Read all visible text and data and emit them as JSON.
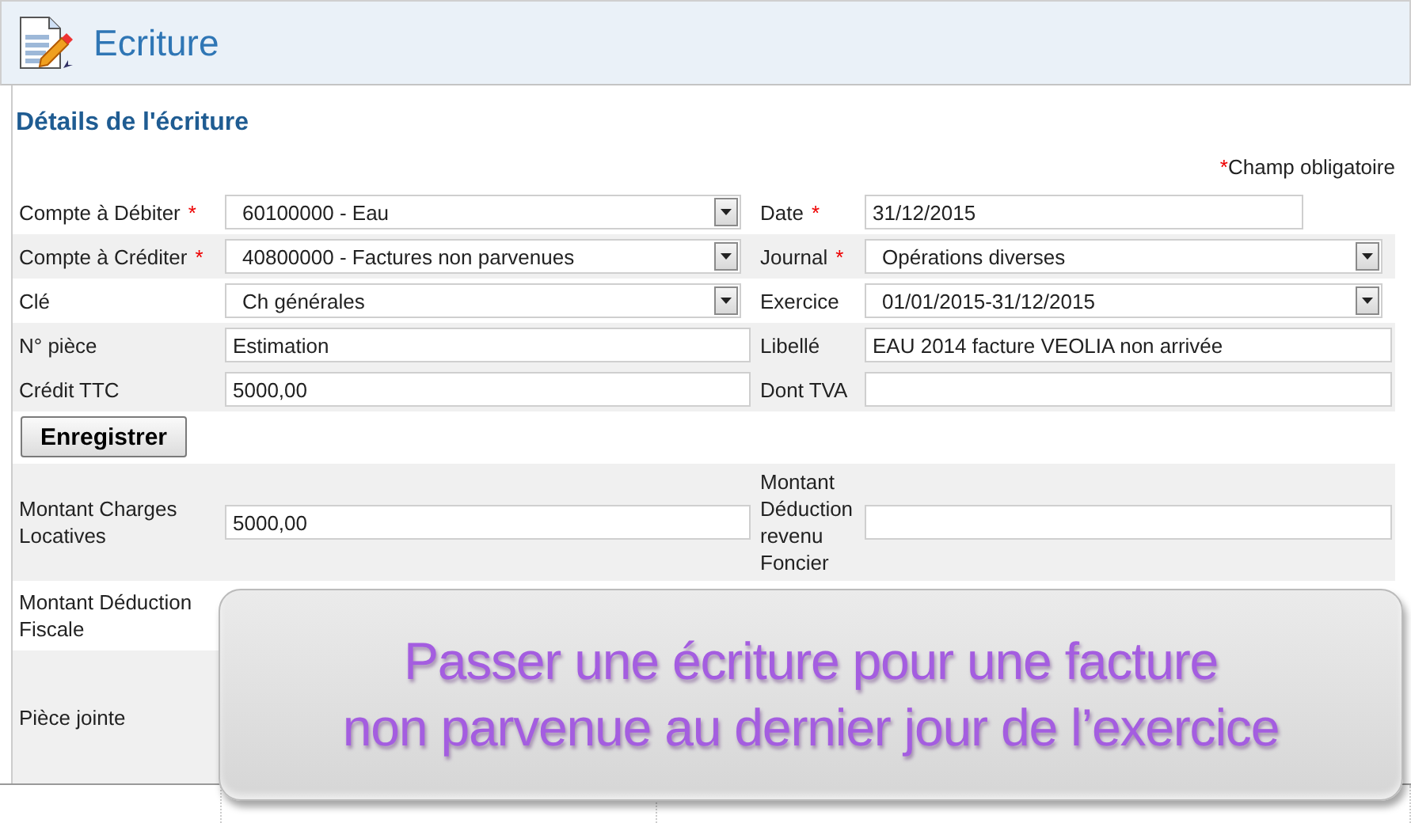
{
  "header": {
    "title": "Ecriture"
  },
  "section_title": "Détails de l'écriture",
  "required_note": {
    "mark": "*",
    "text": "Champ obligatoire"
  },
  "form_rows": [
    {
      "shaded": false,
      "cells": [
        {
          "label": "Compte à Débiter",
          "required": true,
          "field": {
            "kind": "select",
            "value": "60100000 - Eau"
          }
        },
        {
          "label": "Date",
          "required": true,
          "field": {
            "kind": "date",
            "value": "31/12/2015"
          }
        }
      ]
    },
    {
      "shaded": true,
      "cells": [
        {
          "label": "Compte à Créditer",
          "required": true,
          "field": {
            "kind": "select",
            "value": "40800000 - Factures non parvenues"
          }
        },
        {
          "label": "Journal",
          "required": true,
          "field": {
            "kind": "select",
            "value": "Opérations diverses"
          }
        }
      ]
    },
    {
      "shaded": false,
      "cells": [
        {
          "label": "Clé",
          "required": false,
          "field": {
            "kind": "select",
            "value": "Ch générales"
          }
        },
        {
          "label": "Exercice",
          "required": false,
          "field": {
            "kind": "select",
            "value": "01/01/2015-31/12/2015"
          }
        }
      ]
    },
    {
      "shaded": true,
      "cells": [
        {
          "label": "N° pièce",
          "required": false,
          "field": {
            "kind": "input",
            "value": "Estimation"
          }
        },
        {
          "label": "Libellé",
          "required": false,
          "field": {
            "kind": "input",
            "value": "EAU 2014 facture VEOLIA non arrivée"
          }
        }
      ]
    },
    {
      "shaded": true,
      "cells": [
        {
          "label": "Crédit TTC",
          "required": false,
          "field": {
            "kind": "input",
            "value": "5000,00"
          }
        },
        {
          "label": "Dont TVA",
          "required": false,
          "field": {
            "kind": "input"
          }
        }
      ]
    }
  ],
  "save_button": {
    "label": "Enregistrer"
  },
  "extra_rows": [
    {
      "shaded": true,
      "kind": "fields",
      "cells": [
        {
          "label": "Montant Charges Locatives",
          "required": false,
          "field": {
            "kind": "input",
            "value": "5000,00"
          }
        },
        {
          "label": "Montant Déduction revenu Foncier",
          "required": false,
          "field": {
            "kind": "input"
          }
        }
      ]
    },
    {
      "shaded": false,
      "kind": "fields",
      "cells": [
        {
          "label": "Montant Déduction Fiscale",
          "required": false
        }
      ]
    },
    {
      "shaded": true,
      "kind": "attachment",
      "cells": [
        {
          "label": "Pièce jointe",
          "required": false
        }
      ]
    }
  ],
  "callout": {
    "lines": [
      "Passer une écriture pour une facture",
      "non parvenue au dernier jour de l’exercice"
    ]
  }
}
